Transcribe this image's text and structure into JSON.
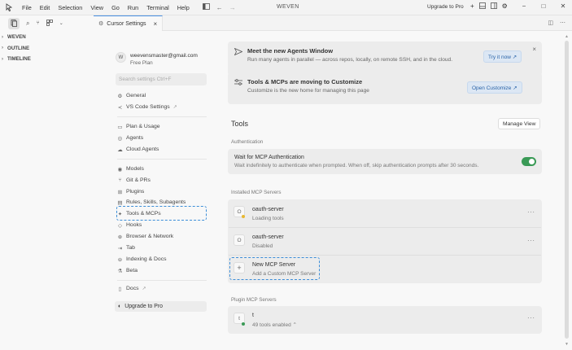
{
  "menubar": {
    "items": [
      "File",
      "Edit",
      "Selection",
      "View",
      "Go",
      "Run",
      "Terminal",
      "Help"
    ]
  },
  "window": {
    "title": "WEVEN",
    "upgrade_link": "Upgrade to Pro"
  },
  "sidebar": {
    "sections": [
      "WEVEN",
      "OUTLINE",
      "TIMELINE"
    ]
  },
  "editor_tab": {
    "label": "Cursor Settings"
  },
  "account": {
    "initial": "W",
    "email": "weevensmaster@gmail.com",
    "plan": "Free Plan"
  },
  "search": {
    "placeholder": "Search settings Ctrl+F"
  },
  "nav": {
    "general": "General",
    "vscode": "VS Code Settings",
    "plan_usage": "Plan & Usage",
    "agents": "Agents",
    "cloud_agents": "Cloud Agents",
    "models": "Models",
    "git_prs": "Git & PRs",
    "plugins": "Plugins",
    "rules": "Rules, Skills, Subagents",
    "tools_mcps": "Tools & MCPs",
    "hooks": "Hooks",
    "browser": "Browser & Network",
    "tab": "Tab",
    "indexing": "Indexing & Docs",
    "beta": "Beta",
    "docs": "Docs",
    "upgrade": "Upgrade to Pro"
  },
  "banner1": {
    "title": "Meet the new Agents Window",
    "subtitle": "Run many agents in parallel — across repos, locally, on remote SSH, and in the cloud.",
    "button": "Try it now ↗"
  },
  "banner2": {
    "title": "Tools & MCPs are moving to Customize",
    "subtitle": "Customize is the new home for managing this page",
    "button": "Open Customize ↗"
  },
  "tools": {
    "heading": "Tools",
    "manage_view": "Manage View"
  },
  "authentication": {
    "label": "Authentication",
    "title": "Wait for MCP Authentication",
    "description": "Wait indefinitely to authenticate when prompted. When off, skip authentication prompts after 30 seconds.",
    "enabled": true
  },
  "installed": {
    "label": "Installed MCP Servers",
    "servers": [
      {
        "icon": "O",
        "name": "oauth-server",
        "status": "Loading tools",
        "status_color": "#e8b730"
      },
      {
        "icon": "O",
        "name": "oauth-server",
        "status": "Disabled"
      }
    ],
    "new_server": {
      "title": "New MCP Server",
      "subtitle": "Add a Custom MCP Server"
    }
  },
  "plugin": {
    "label": "Plugin MCP Servers",
    "servers": [
      {
        "icon": "t",
        "name": "t",
        "status": "49 tools enabled ⌃",
        "status_color": "#3a9a56"
      }
    ]
  },
  "colors": {
    "accent": "#3d8ed8",
    "toggle_on": "#3a9a56"
  }
}
